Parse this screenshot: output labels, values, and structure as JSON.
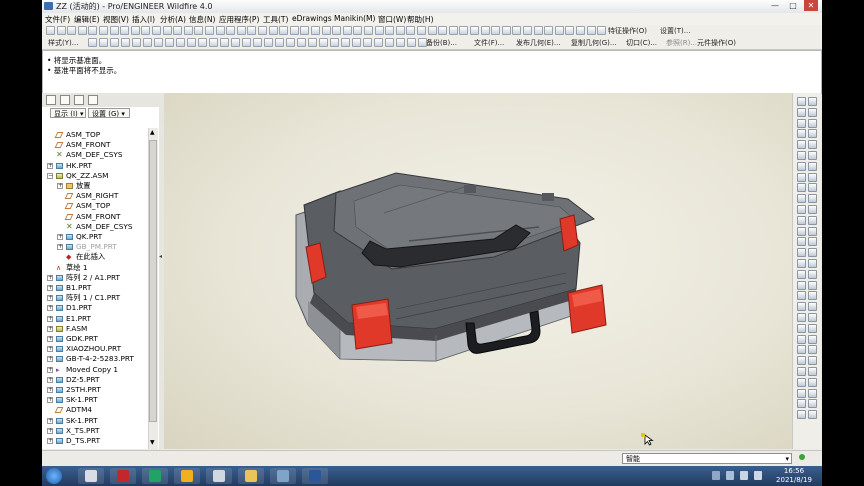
{
  "window": {
    "title": "ZZ (活动的) - Pro/ENGINEER Wildfire 4.0",
    "min_glyph": "—",
    "max_glyph": "□",
    "close_glyph": "✕"
  },
  "menu": [
    "文件(F)",
    "编辑(E)",
    "视图(V)",
    "插入(I)",
    "分析(A)",
    "信息(N)",
    "应用程序(P)",
    "工具(T)",
    "eDrawings",
    "Manikin(M)",
    "窗口(W)",
    "帮助(H)"
  ],
  "toolbar1": {
    "feature_ops": "特征操作(O)",
    "settings": "设置(T)..."
  },
  "toolbar2": {
    "style": "样式(Y)...",
    "backup": "备份(B)...",
    "file": "文件(F)...",
    "publish_geom": "发布几何(E)...",
    "copy_geom": "复制几何(G)...",
    "cut": "切口(C)...",
    "reference": "参照(R)...",
    "component_ops": "元件操作(O)"
  },
  "messages": [
    "• 将显示基准面。",
    "• 基准平面将不显示。"
  ],
  "navigator": {
    "show_label": "显示 (I)",
    "settings_label": "设置 (G)",
    "tree": [
      {
        "label": "ASM_TOP",
        "icon": "datum-plane-icon",
        "indent": 1,
        "expand": ""
      },
      {
        "label": "ASM_FRONT",
        "icon": "datum-plane-icon",
        "indent": 1,
        "expand": ""
      },
      {
        "label": "ASM_DEF_CSYS",
        "icon": "csys-icon",
        "indent": 1,
        "expand": ""
      },
      {
        "label": "HK.PRT",
        "icon": "part-icon",
        "indent": 1,
        "expand": "+"
      },
      {
        "label": "QK_ZZ.ASM",
        "icon": "assembly-icon",
        "indent": 1,
        "expand": "−"
      },
      {
        "label": "放置",
        "icon": "folder-icon",
        "indent": 2,
        "expand": "+"
      },
      {
        "label": "ASM_RIGHT",
        "icon": "datum-plane-icon",
        "indent": 2,
        "expand": ""
      },
      {
        "label": "ASM_TOP",
        "icon": "datum-plane-icon",
        "indent": 2,
        "expand": ""
      },
      {
        "label": "ASM_FRONT",
        "icon": "datum-plane-icon",
        "indent": 2,
        "expand": ""
      },
      {
        "label": "ASM_DEF_CSYS",
        "icon": "csys-icon",
        "indent": 2,
        "expand": ""
      },
      {
        "label": "QK.PRT",
        "icon": "part-icon",
        "indent": 2,
        "expand": "+"
      },
      {
        "label": "GB_PM.PRT",
        "icon": "part-icon",
        "indent": 2,
        "expand": "+",
        "dim": true
      },
      {
        "label": "在此插入",
        "icon": "insert-here-icon",
        "indent": 2,
        "expand": ""
      },
      {
        "label": "草绘 1",
        "icon": "sketch-icon",
        "indent": 1,
        "expand": ""
      },
      {
        "label": "阵列 2 / A1.PRT",
        "icon": "part-icon",
        "indent": 1,
        "expand": "+"
      },
      {
        "label": "B1.PRT",
        "icon": "part-icon",
        "indent": 1,
        "expand": "+"
      },
      {
        "label": "阵列 1 / C1.PRT",
        "icon": "part-icon",
        "indent": 1,
        "expand": "+"
      },
      {
        "label": "D1.PRT",
        "icon": "part-icon",
        "indent": 1,
        "expand": "+"
      },
      {
        "label": "E1.PRT",
        "icon": "part-icon",
        "indent": 1,
        "expand": "+"
      },
      {
        "label": "F.ASM",
        "icon": "assembly-icon",
        "indent": 1,
        "expand": "+"
      },
      {
        "label": "GDK.PRT",
        "icon": "part-icon",
        "indent": 1,
        "expand": "+"
      },
      {
        "label": "XIAOZHOU.PRT",
        "icon": "part-icon",
        "indent": 1,
        "expand": "+"
      },
      {
        "label": "GB-T-4-2-5283.PRT",
        "icon": "part-icon",
        "indent": 1,
        "expand": "+"
      },
      {
        "label": "Moved Copy 1",
        "icon": "group-icon",
        "indent": 1,
        "expand": "+"
      },
      {
        "label": "DZ-5.PRT",
        "icon": "part-icon",
        "indent": 1,
        "expand": "+"
      },
      {
        "label": "2STH.PRT",
        "icon": "part-icon",
        "indent": 1,
        "expand": "+"
      },
      {
        "label": "SK-1.PRT",
        "icon": "part-icon",
        "indent": 1,
        "expand": "+"
      },
      {
        "label": "ADTM4",
        "icon": "datum-plane-icon",
        "indent": 1,
        "expand": ""
      },
      {
        "label": "SK-1.PRT",
        "icon": "part-icon",
        "indent": 1,
        "expand": "+"
      },
      {
        "label": "X_TS.PRT",
        "icon": "part-icon",
        "indent": 1,
        "expand": "+"
      },
      {
        "label": "D_TS.PRT",
        "icon": "part-icon",
        "indent": 1,
        "expand": "+"
      }
    ]
  },
  "status": {
    "filter_value": "智能"
  },
  "taskbar": {
    "time": "16:56",
    "date": "2021/8/19",
    "apps": [
      "start-orb-icon",
      "explorer-icon",
      "acrobat-icon",
      "wps-sheet-icon",
      "chrome-icon",
      "calculator-icon",
      "folder-icon",
      "proe-icon",
      "word-icon"
    ]
  },
  "colors": {
    "viewport_bg": "#ece9dc",
    "case_body": "#6b6e73",
    "case_latch": "#e0392a",
    "taskbar": "#2c4a74"
  }
}
